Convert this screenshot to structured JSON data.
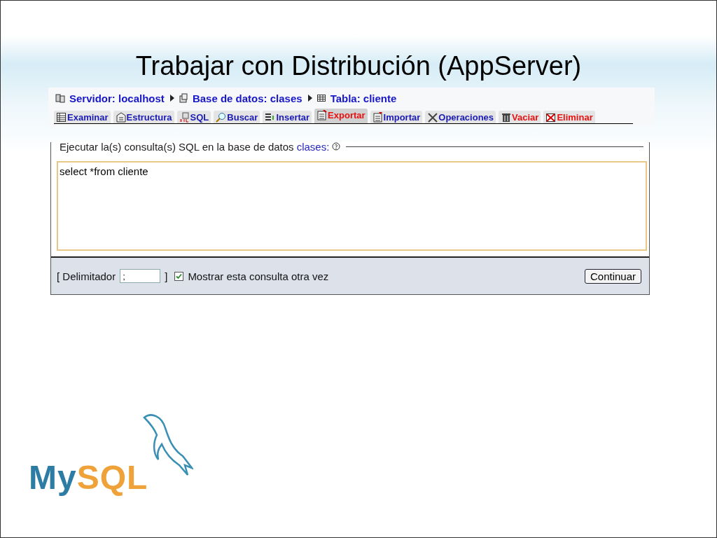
{
  "slide": {
    "title": "Trabajar con Distribución (AppServer)"
  },
  "breadcrumb": [
    {
      "label": "Servidor: localhost"
    },
    {
      "label": "Base de datos: clases"
    },
    {
      "label": "Tabla: cliente"
    }
  ],
  "tabs": [
    {
      "label": "Examinar",
      "selected": false,
      "danger": false
    },
    {
      "label": "Estructura",
      "selected": false,
      "danger": false
    },
    {
      "label": "SQL",
      "selected": false,
      "danger": false
    },
    {
      "label": "Buscar",
      "selected": false,
      "danger": false
    },
    {
      "label": "Insertar",
      "selected": false,
      "danger": false
    },
    {
      "label": "Exportar",
      "selected": true,
      "danger": false
    },
    {
      "label": "Importar",
      "selected": false,
      "danger": false
    },
    {
      "label": "Operaciones",
      "selected": false,
      "danger": false
    },
    {
      "label": "Vaciar",
      "selected": false,
      "danger": true
    },
    {
      "label": "Eliminar",
      "selected": false,
      "danger": true
    }
  ],
  "query_form": {
    "legend": "Ejecutar la(s) consulta(s) SQL en la base de datos",
    "database": "clases:",
    "query": "select *from cliente",
    "delimiter_open": "[ Delimitador",
    "delimiter_value": ";",
    "delimiter_close": "]",
    "show_again": {
      "label": "Mostrar esta consulta otra vez",
      "checked": true
    },
    "submit": "Continuar"
  },
  "logo": {
    "lead": "My",
    "tail": "SQL"
  }
}
